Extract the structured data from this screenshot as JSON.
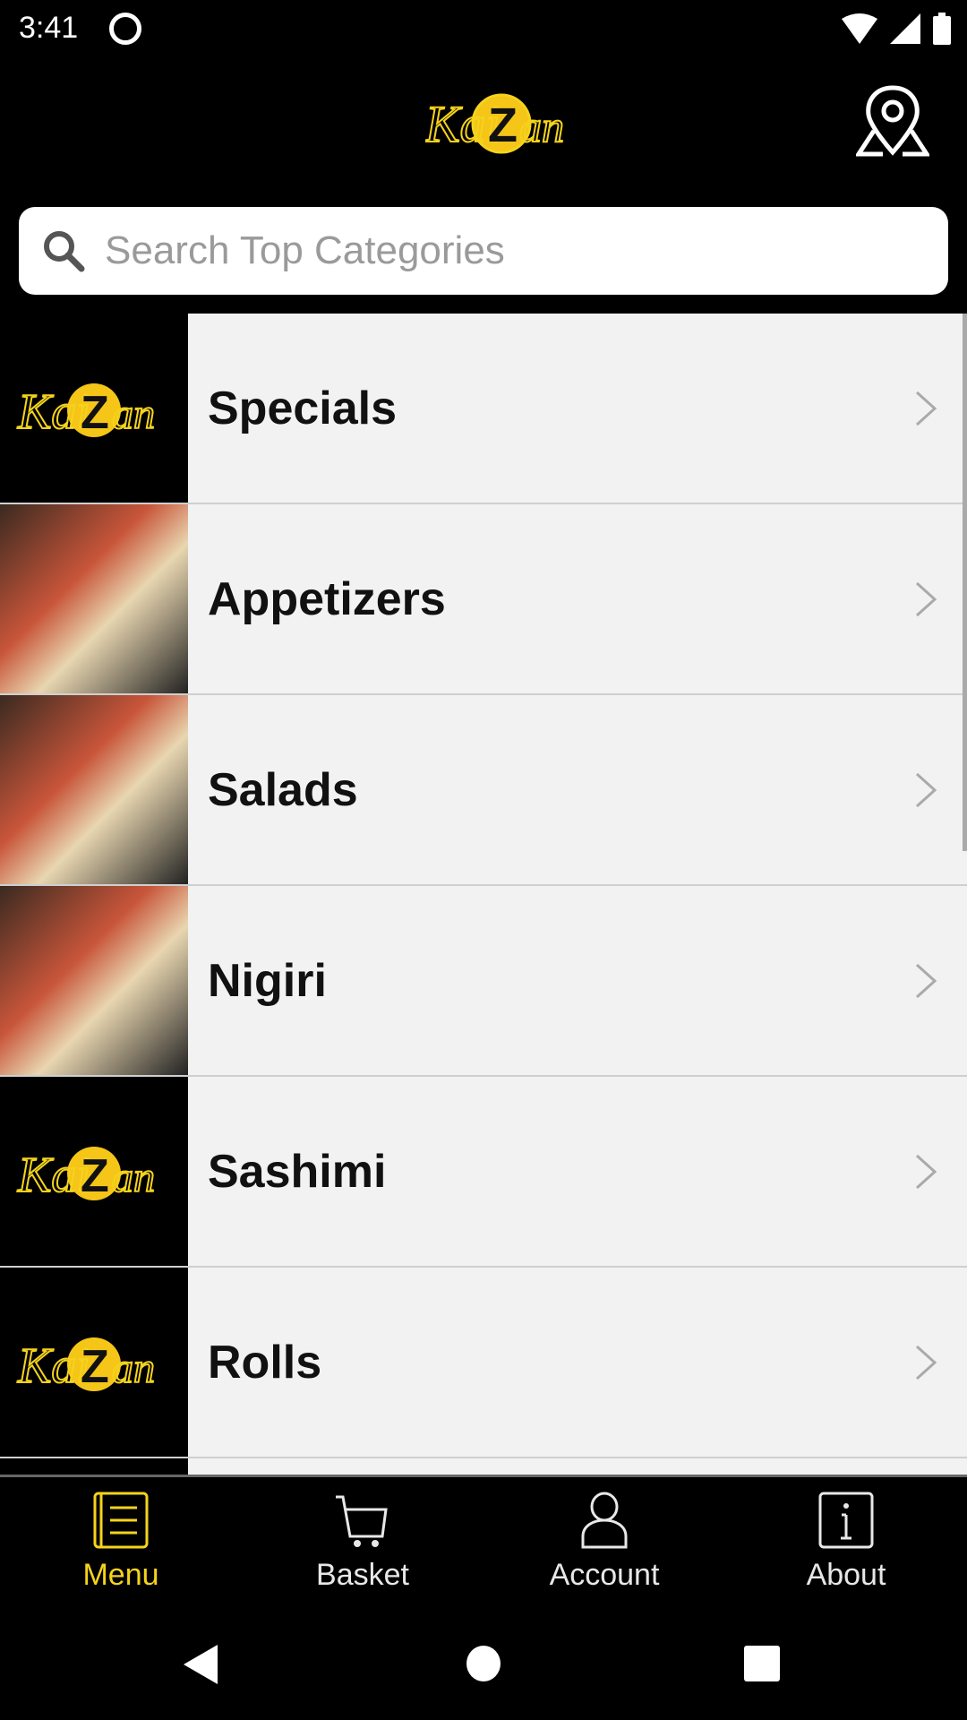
{
  "status": {
    "time": "3:41"
  },
  "header": {
    "logo_text": "KaiZan"
  },
  "search": {
    "placeholder": "Search Top Categories",
    "value": ""
  },
  "categories": [
    {
      "label": "Specials",
      "thumb": "logo"
    },
    {
      "label": "Appetizers",
      "thumb": "photo"
    },
    {
      "label": "Salads",
      "thumb": "photo"
    },
    {
      "label": "Nigiri",
      "thumb": "photo"
    },
    {
      "label": "Sashimi",
      "thumb": "logo"
    },
    {
      "label": "Rolls",
      "thumb": "logo"
    }
  ],
  "nav": {
    "items": [
      {
        "label": "Menu",
        "icon": "menu-book-icon",
        "active": true
      },
      {
        "label": "Basket",
        "icon": "cart-icon"
      },
      {
        "label": "Account",
        "icon": "person-icon"
      },
      {
        "label": "About",
        "icon": "info-icon"
      }
    ]
  },
  "colors": {
    "accent": "#f5d31c",
    "background": "#000000",
    "row": "#f2f2f2"
  }
}
